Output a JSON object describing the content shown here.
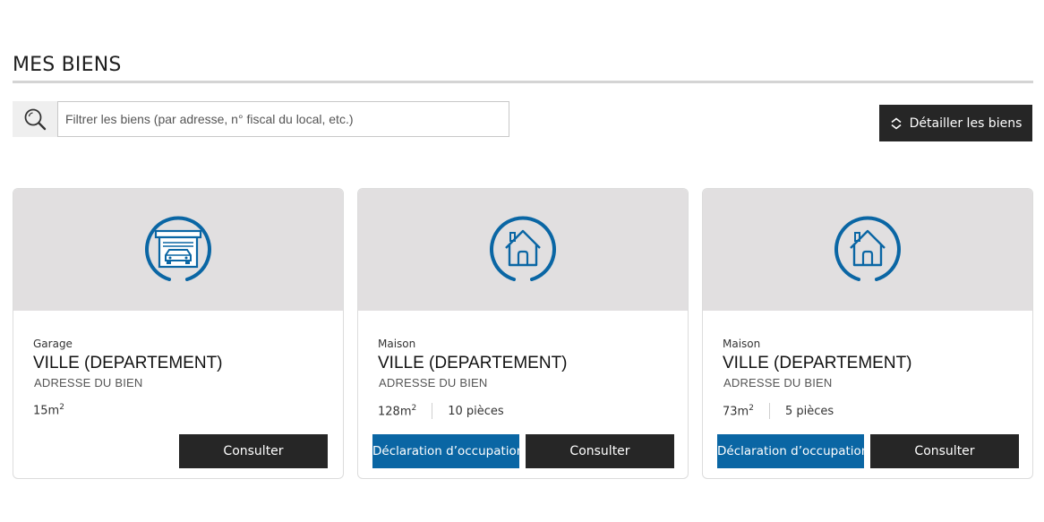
{
  "page": {
    "title": "MES BIENS"
  },
  "search": {
    "placeholder": "Filtrer les biens (par adresse, n° fiscal du local, etc.)",
    "icon": "search-icon"
  },
  "toolbar": {
    "detail_label": "Détailler les biens",
    "detail_icon": "chevron-up-down-icon"
  },
  "colors": {
    "accent_blue": "#0a66a4",
    "dark_button": "#262626",
    "media_background": "#e1dfe0"
  },
  "properties": [
    {
      "icon": "garage-icon",
      "type": "Garage",
      "city": "VILLE (DEPARTEMENT)",
      "address": "ADRESSE DU BIEN",
      "area": "15m",
      "area_unit_exp": "2",
      "rooms": "",
      "declare_label": "",
      "consult_label": "Consulter"
    },
    {
      "icon": "house-icon",
      "type": "Maison",
      "city": "VILLE (DEPARTEMENT)",
      "address": "ADRESSE DU BIEN",
      "area": "128m",
      "area_unit_exp": "2",
      "rooms": "10 pièces",
      "declare_label": "Déclaration d’occupation",
      "consult_label": "Consulter"
    },
    {
      "icon": "house-icon",
      "type": "Maison",
      "city": "VILLE (DEPARTEMENT)",
      "address": "ADRESSE DU BIEN",
      "area": "73m",
      "area_unit_exp": "2",
      "rooms": "5 pièces",
      "declare_label": "Déclaration d’occupation",
      "consult_label": "Consulter"
    }
  ]
}
